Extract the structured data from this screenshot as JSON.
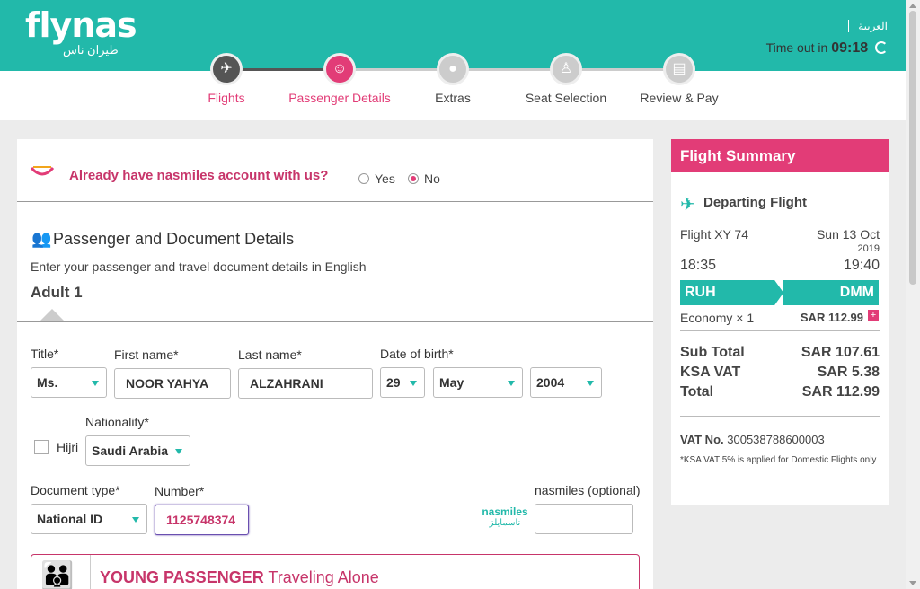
{
  "header": {
    "logo_en": "flynas",
    "logo_ar": "طيران ناس",
    "language": "العربية",
    "timeout_label": "Time out in",
    "timeout_value": "09:18"
  },
  "steps": [
    {
      "label": "Flights",
      "icon": "plane-icon",
      "state": "done"
    },
    {
      "label": "Passenger Details",
      "icon": "passengers-icon",
      "state": "active"
    },
    {
      "label": "Extras",
      "icon": "meal-icon",
      "state": "todo"
    },
    {
      "label": "Seat Selection",
      "icon": "seat-icon",
      "state": "todo"
    },
    {
      "label": "Review & Pay",
      "icon": "payment-icon",
      "state": "todo"
    }
  ],
  "account": {
    "question": "Already have nasmiles account with us?",
    "yes": "Yes",
    "no": "No",
    "selected": "No"
  },
  "passenger": {
    "section_title": "Passenger and Document Details",
    "section_sub": "Enter your passenger and travel document details in English",
    "adult_label": "Adult 1",
    "title_label": "Title*",
    "title_value": "Ms.",
    "first_name_label": "First name*",
    "first_name_value": "NOOR YAHYA",
    "last_name_label": "Last name*",
    "last_name_value": "ALZAHRANI",
    "dob_label": "Date of birth*",
    "dob_day": "29",
    "dob_month": "May",
    "dob_year": "2004",
    "hijri_label": "Hijri",
    "nationality_label": "Nationality*",
    "nationality_value": "Saudi Arabia",
    "doc_type_label": "Document type*",
    "doc_type_value": "National ID",
    "number_label": "Number*",
    "number_value": "1125748374",
    "nasmiles_label": "nasmiles (optional)",
    "nasmiles_value": "",
    "nasmiles_logo_en": "nasmiles",
    "nasmiles_logo_ar": "ناسمايلز"
  },
  "young": {
    "title_bold": "YOUNG PASSENGER",
    "title_rest": " Traveling Alone"
  },
  "summary": {
    "title": "Flight Summary",
    "departing": "Departing Flight",
    "flight_no": "Flight XY 74",
    "date": "Sun 13 Oct",
    "year": "2019",
    "dep_time": "18:35",
    "arr_time": "19:40",
    "from": "RUH",
    "to": "DMM",
    "fare_class": "Economy × 1",
    "fare_price": "SAR 112.99",
    "subtotal_label": "Sub Total",
    "subtotal_value": "SAR 107.61",
    "vat_label": "KSA VAT",
    "vat_value": "SAR 5.38",
    "total_label": "Total",
    "total_value": "SAR 112.99",
    "vat_no_label": "VAT No.",
    "vat_no_value": "300538788600003",
    "vat_note": "*KSA VAT 5% is applied for Domestic Flights only"
  },
  "colors": {
    "teal": "#22b9aa",
    "pink": "#e23c77"
  }
}
